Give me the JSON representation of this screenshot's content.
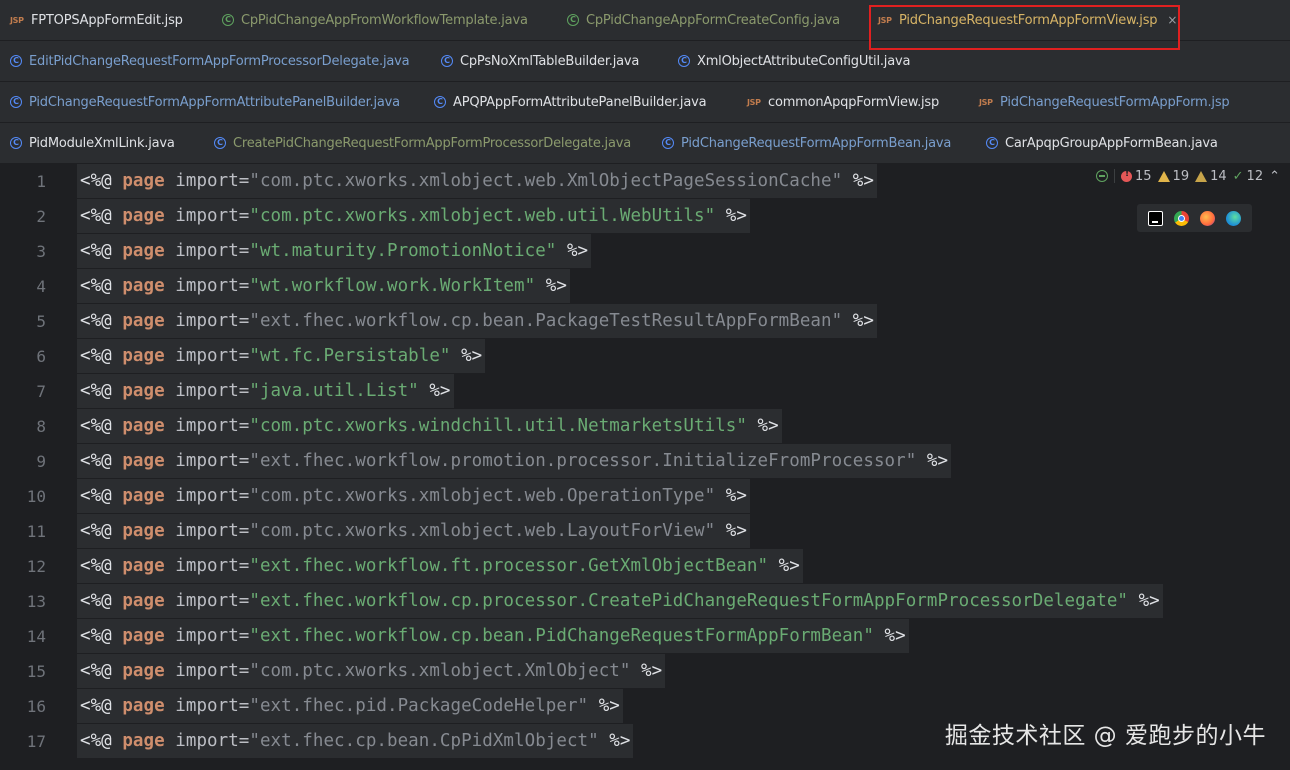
{
  "tabs": [
    [
      {
        "name": "FPTOPSAppFormEdit.jsp",
        "icon": "jsp",
        "style": "normal"
      },
      {
        "name": "CpPidChangeAppFromWorkflowTemplate.java",
        "icon": "class-green",
        "style": "dim"
      },
      {
        "name": "CpPidChangeAppFormCreateConfig.java",
        "icon": "class-green",
        "style": "dim"
      },
      {
        "name": "PidChangeRequestFormAppFormView.jsp",
        "icon": "jsp",
        "style": "active",
        "close": "×"
      }
    ],
    [
      {
        "name": "EditPidChangeRequestFormAppFormProcessorDelegate.java",
        "icon": "class",
        "style": "dim"
      },
      {
        "name": "CpPsNoXmlTableBuilder.java",
        "icon": "class",
        "style": "normal"
      },
      {
        "name": "XmlObjectAttributeConfigUtil.java",
        "icon": "class",
        "style": "normal"
      }
    ],
    [
      {
        "name": "PidChangeRequestFormAppFormAttributePanelBuilder.java",
        "icon": "class",
        "style": "dim-blue"
      },
      {
        "name": "APQPAppFormAttributePanelBuilder.java",
        "icon": "class",
        "style": "normal"
      },
      {
        "name": "commonApqpFormView.jsp",
        "icon": "jsp",
        "style": "normal"
      },
      {
        "name": "PidChangeRequestFormAppForm.jsp",
        "icon": "jsp",
        "style": "dim-blue"
      }
    ],
    [
      {
        "name": "PidModuleXmlLink.java",
        "icon": "class",
        "style": "normal"
      },
      {
        "name": "CreatePidChangeRequestFormAppFormProcessorDelegate.java",
        "icon": "class",
        "style": "dim"
      },
      {
        "name": "PidChangeRequestFormAppFormBean.java",
        "icon": "class",
        "style": "dim-blue"
      },
      {
        "name": "CarApqpGroupAppFormBean.java",
        "icon": "class",
        "style": "normal"
      }
    ]
  ],
  "inspections": {
    "errors": "15",
    "warnings": "19",
    "weak_warnings": "14",
    "typos": "12"
  },
  "browsers": [
    "intellij-icon",
    "chrome-icon",
    "firefox-icon",
    "edge-icon"
  ],
  "code_lines": [
    {
      "n": "1",
      "import": "com.ptc.xworks.xmlobject.web.XmlObjectPageSessionCache",
      "used": false
    },
    {
      "n": "2",
      "import": "com.ptc.xworks.xmlobject.web.util.WebUtils",
      "used": true
    },
    {
      "n": "3",
      "import": "wt.maturity.PromotionNotice",
      "used": true
    },
    {
      "n": "4",
      "import": "wt.workflow.work.WorkItem",
      "used": true
    },
    {
      "n": "5",
      "import": "ext.fhec.workflow.cp.bean.PackageTestResultAppFormBean",
      "used": false
    },
    {
      "n": "6",
      "import": "wt.fc.Persistable",
      "used": true
    },
    {
      "n": "7",
      "import": "java.util.List",
      "used": true
    },
    {
      "n": "8",
      "import": "com.ptc.xworks.windchill.util.NetmarketsUtils",
      "used": true
    },
    {
      "n": "9",
      "import": "ext.fhec.workflow.promotion.processor.InitializeFromProcessor",
      "used": false
    },
    {
      "n": "10",
      "import": "com.ptc.xworks.xmlobject.web.OperationType",
      "used": false
    },
    {
      "n": "11",
      "import": "com.ptc.xworks.xmlobject.web.LayoutForView",
      "used": false
    },
    {
      "n": "12",
      "import": "ext.fhec.workflow.ft.processor.GetXmlObjectBean",
      "used": true
    },
    {
      "n": "13",
      "import": "ext.fhec.workflow.cp.processor.CreatePidChangeRequestFormAppFormProcessorDelegate",
      "used": true
    },
    {
      "n": "14",
      "import": "ext.fhec.workflow.cp.bean.PidChangeRequestFormAppFormBean",
      "used": true
    },
    {
      "n": "15",
      "import": "com.ptc.xworks.xmlobject.XmlObject",
      "used": false
    },
    {
      "n": "16",
      "import": "ext.fhec.pid.PackageCodeHelper",
      "used": false
    },
    {
      "n": "17",
      "import": "ext.fhec.cp.bean.CpPidXmlObject",
      "used": false
    }
  ],
  "syntax": {
    "open": "<%@ ",
    "directive": "page",
    "attr": " import=",
    "close": " %>"
  },
  "watermark": "掘金技术社区 @ 爱跑步的小牛"
}
